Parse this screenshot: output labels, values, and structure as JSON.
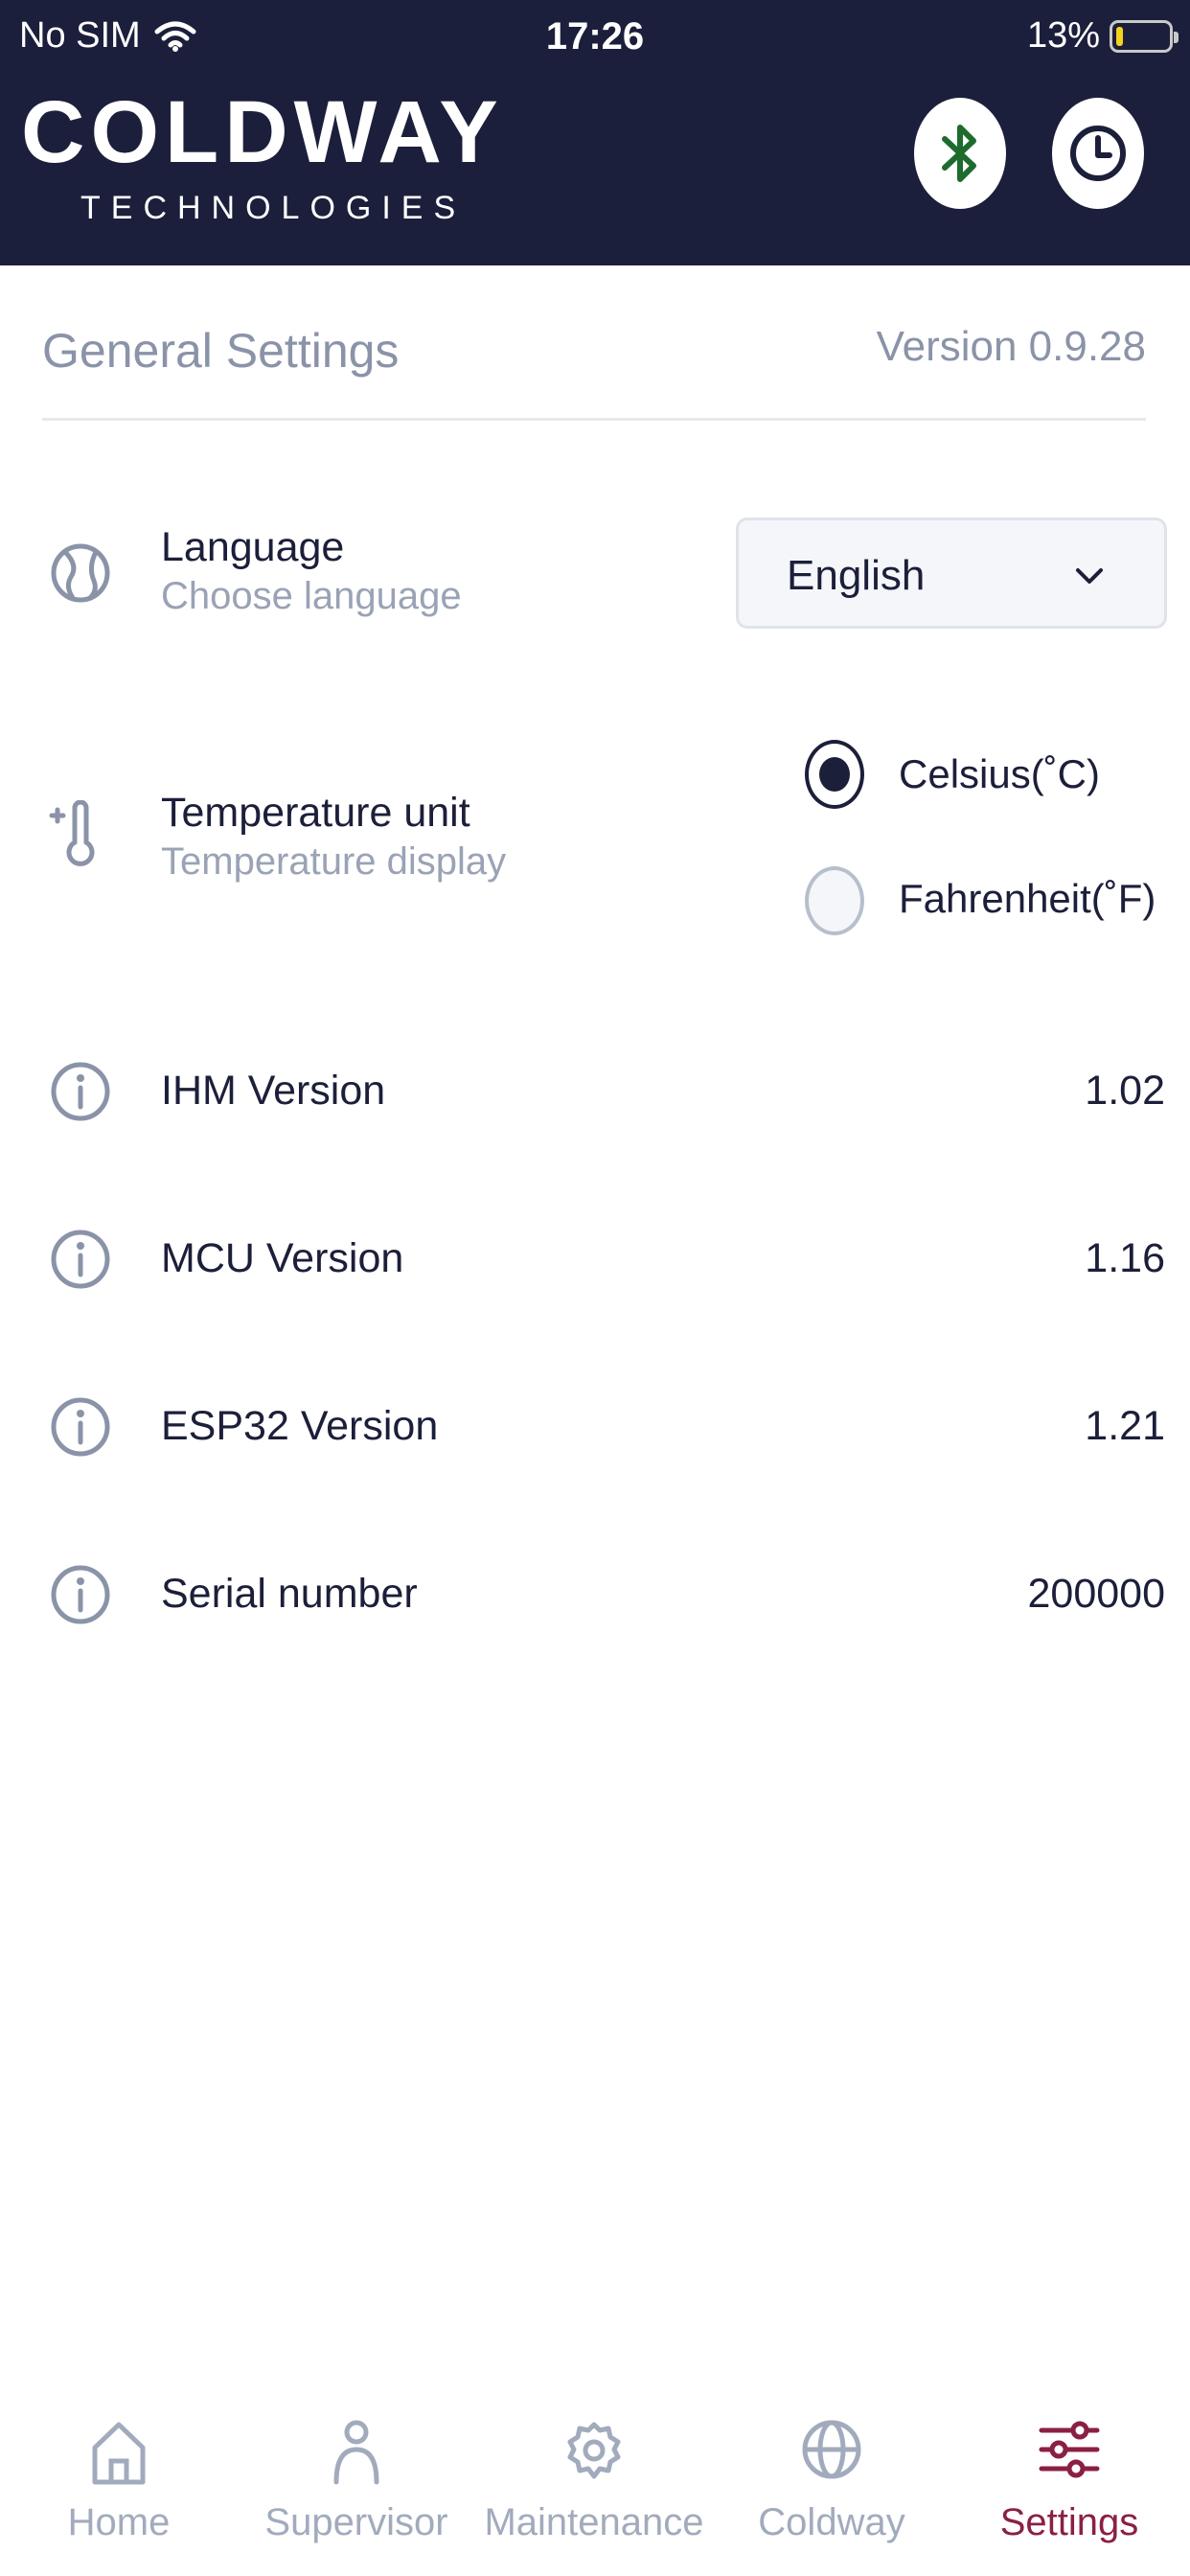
{
  "status_bar": {
    "carrier": "No SIM",
    "time": "17:26",
    "battery": "13%",
    "battery_level": 0.13
  },
  "header": {
    "brand": "COLDWAY",
    "brand_sub": "TECHNOLOGIES",
    "bluetooth_color": "#1e6b2e"
  },
  "settings": {
    "title": "General Settings",
    "version": "Version 0.9.28",
    "language": {
      "title": "Language",
      "subtitle": "Choose language",
      "value": "English"
    },
    "temperature": {
      "title": "Temperature unit",
      "subtitle": "Temperature display",
      "options": [
        "Celsius(˚C)",
        "Fahrenheit(˚F)"
      ],
      "selected": "Celsius(˚C)"
    },
    "info": [
      {
        "label": "IHM Version",
        "value": "1.02"
      },
      {
        "label": "MCU Version",
        "value": "1.16"
      },
      {
        "label": "ESP32 Version",
        "value": "1.21"
      },
      {
        "label": "Serial number",
        "value": "200000"
      }
    ]
  },
  "tabs": [
    {
      "label": "Home",
      "icon": "home-icon"
    },
    {
      "label": "Supervisor",
      "icon": "person-icon"
    },
    {
      "label": "Maintenance",
      "icon": "gear-icon"
    },
    {
      "label": "Coldway",
      "icon": "globe-icon"
    },
    {
      "label": "Settings",
      "icon": "sliders-icon",
      "active": true
    }
  ],
  "colors": {
    "header_bg": "#1c1f3b",
    "accent": "#8b1f45",
    "muted": "#a2abbd"
  }
}
